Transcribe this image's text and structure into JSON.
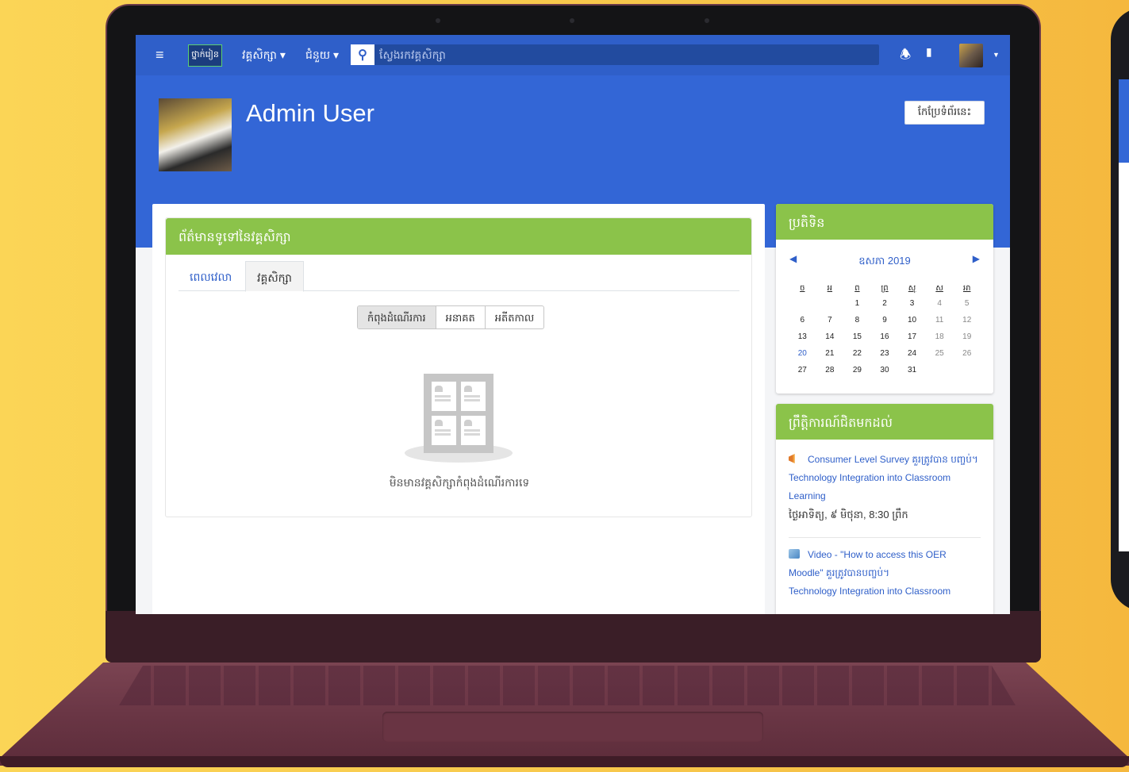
{
  "navbar": {
    "brand": "ថ្នាក់រៀន",
    "courses_menu": "វគ្គសិក្សា ▾",
    "help_menu": "ជំនួយ ▾",
    "search_placeholder": "ស្វែងរកវគ្គសិក្សា"
  },
  "header": {
    "user_name": "Admin User",
    "edit_button": "កែប្រែទំព័រនេះ"
  },
  "course_overview": {
    "title": "ព័ត៌មានទូទៅនៃវគ្គសិក្សា",
    "tabs": [
      "ពេលវេលា",
      "វគ្គសិក្សា"
    ],
    "filters": [
      "កំពុងដំណើរការ",
      "អនាគត",
      "អតីតកាល"
    ],
    "empty_message": "មិនមានវគ្គសិក្សាកំពុងដំណើរការទេ"
  },
  "calendar": {
    "title": "ប្រតិទិន",
    "month_label": "ឧសភា 2019",
    "prev": "◀",
    "next": "▶",
    "day_headers": [
      "ច",
      "អ",
      "ព",
      "ព្រ",
      "សុ",
      "ស",
      "អា"
    ],
    "weeks": [
      [
        "",
        "",
        "1",
        "2",
        "3",
        "4",
        "5"
      ],
      [
        "6",
        "7",
        "8",
        "9",
        "10",
        "11",
        "12"
      ],
      [
        "13",
        "14",
        "15",
        "16",
        "17",
        "18",
        "19"
      ],
      [
        "20",
        "21",
        "22",
        "23",
        "24",
        "25",
        "26"
      ],
      [
        "27",
        "28",
        "29",
        "30",
        "31",
        "",
        ""
      ]
    ]
  },
  "upcoming_events": {
    "title": "ព្រឹត្តិការណ៍ជិតមកដល់",
    "items": [
      {
        "icon": "megaphone-icon",
        "title": "Consumer Level Survey គួរត្រូវបាន បញ្ចប់។",
        "course": "Technology Integration into Classroom Learning",
        "date": "ថ្ងៃអាទិត្យ, ៩ មិថុនា, 8:30 ព្រឹក"
      },
      {
        "icon": "video-icon",
        "title": "Video - \"How to access this OER Moodle\" គួរត្រូវបានបញ្ចប់។",
        "course": "Technology Integration into Classroom"
      }
    ]
  },
  "colors": {
    "navbar": "#2f5fc9",
    "header": "#3366d6",
    "block_header": "#8bc34a",
    "background": "#f9c74f"
  }
}
